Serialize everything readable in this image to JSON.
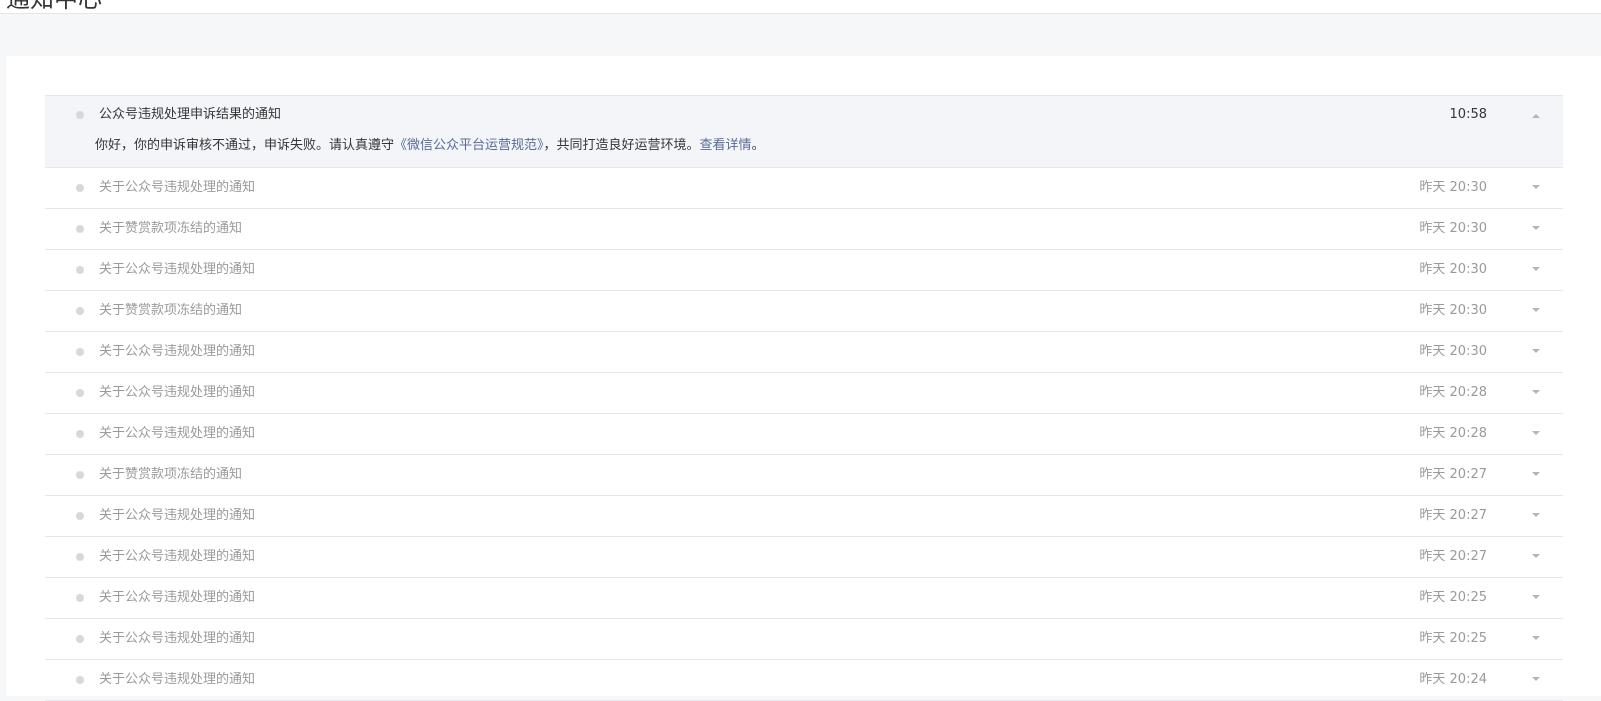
{
  "page": {
    "title": "通知中心"
  },
  "notifications": [
    {
      "title": "公众号违规处理申诉结果的通知",
      "time": "10:58",
      "expanded": true,
      "body": {
        "prefix": "你好，你的申诉审核不通过，申诉失败。请认真遵守",
        "rules_link": "《微信公众平台运营规范》",
        "middle": "，共同打造良好运营环境。",
        "details_link": "查看详情",
        "suffix": "。"
      }
    },
    {
      "title": "关于公众号违规处理的通知",
      "time": "昨天 20:30"
    },
    {
      "title": "关于赞赏款项冻结的通知",
      "time": "昨天 20:30"
    },
    {
      "title": "关于公众号违规处理的通知",
      "time": "昨天 20:30"
    },
    {
      "title": "关于赞赏款项冻结的通知",
      "time": "昨天 20:30"
    },
    {
      "title": "关于公众号违规处理的通知",
      "time": "昨天 20:30"
    },
    {
      "title": "关于公众号违规处理的通知",
      "time": "昨天 20:28"
    },
    {
      "title": "关于公众号违规处理的通知",
      "time": "昨天 20:28"
    },
    {
      "title": "关于赞赏款项冻结的通知",
      "time": "昨天 20:27"
    },
    {
      "title": "关于公众号违规处理的通知",
      "time": "昨天 20:27"
    },
    {
      "title": "关于公众号违规处理的通知",
      "time": "昨天 20:27"
    },
    {
      "title": "关于公众号违规处理的通知",
      "time": "昨天 20:25"
    },
    {
      "title": "关于公众号违规处理的通知",
      "time": "昨天 20:25"
    },
    {
      "title": "关于公众号违规处理的通知",
      "time": "昨天 20:24"
    }
  ],
  "colors": {
    "unread_dot": "#d8d8d8",
    "link": "#576b95",
    "expanded_bg": "#f4f5f9"
  }
}
